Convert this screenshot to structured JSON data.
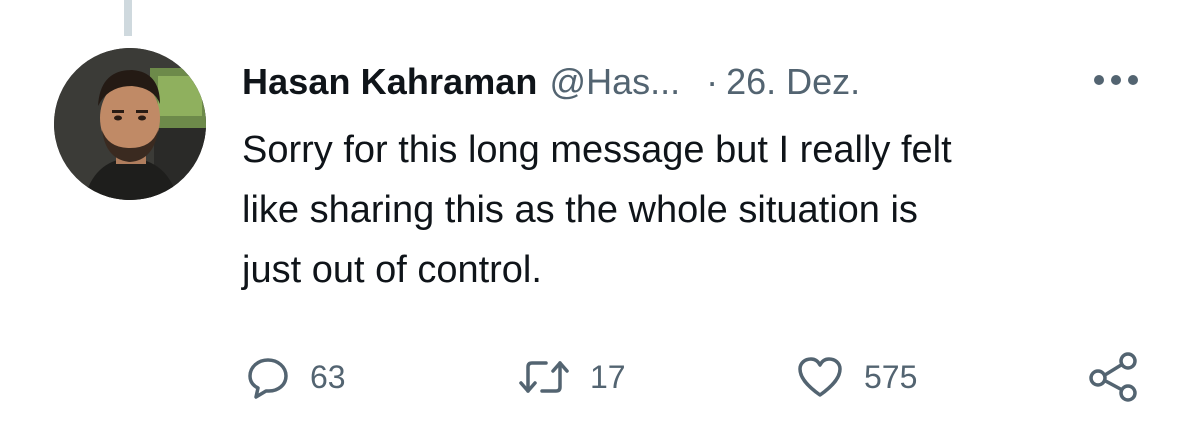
{
  "tweet": {
    "author_name": "Hasan Kahraman",
    "handle": "@Has...",
    "separator": "·",
    "date": "26. Dez.",
    "text_lines": [
      "Sorry for this long message but I really felt",
      "like sharing this as the whole situation is",
      "just out of control."
    ]
  },
  "actions": {
    "reply_count": "63",
    "retweet_count": "17",
    "like_count": "575"
  },
  "icons": {
    "reply": "reply-icon",
    "retweet": "retweet-icon",
    "like": "heart-icon",
    "share": "share-icon",
    "more": "more-icon"
  },
  "colors": {
    "text_primary": "#0f1419",
    "text_secondary": "#536471",
    "thread_line": "#cfd9de",
    "background": "#ffffff"
  }
}
